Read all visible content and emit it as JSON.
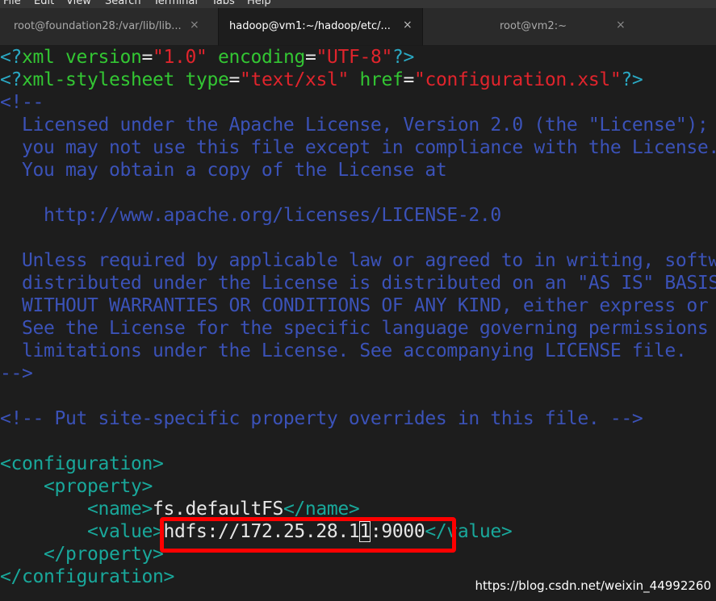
{
  "menu": {
    "items": [
      "File",
      "Edit",
      "View",
      "Search",
      "Terminal",
      "Tabs",
      "Help"
    ]
  },
  "tabs": [
    {
      "label": "root@foundation28:/var/lib/lib...",
      "close": "×",
      "active": false
    },
    {
      "label": "hadoop@vm1:~/hadoop/etc/...",
      "close": "×",
      "active": true
    },
    {
      "label": "root@vm2:~",
      "close": "×",
      "active": false
    }
  ],
  "colors": {
    "punct": "#2aa9c4",
    "keyword": "#33c633",
    "string": "#e0242c",
    "comment": "#3b52b8",
    "tag": "#19a89b",
    "text": "#e6e6e6",
    "highlight": "#ff0000"
  },
  "xml": {
    "decl": {
      "open": "<?",
      "name": "xml",
      "attr1": "version",
      "eq": "=",
      "val1": "\"1.0\"",
      "attr2": "encoding",
      "val2": "\"UTF-8\"",
      "close": "?>"
    },
    "stylesheet": {
      "open": "<?",
      "name": "xml-stylesheet",
      "attr1": "type",
      "eq": "=",
      "val1": "\"text/xsl\"",
      "attr2": "href",
      "val2": "\"configuration.xsl\"",
      "close": "?>"
    },
    "license_comment": [
      "<!--",
      "  Licensed under the Apache License, Version 2.0 (the \"License\");",
      "  you may not use this file except in compliance with the License.",
      "  You may obtain a copy of the License at",
      "",
      "    http://www.apache.org/licenses/LICENSE-2.0",
      "",
      "  Unless required by applicable law or agreed to in writing, software",
      "  distributed under the License is distributed on an \"AS IS\" BASIS,",
      "  WITHOUT WARRANTIES OR CONDITIONS OF ANY KIND, either express or implied.",
      "  See the License for the specific language governing permissions and",
      "  limitations under the License. See accompanying LICENSE file.",
      "-->"
    ],
    "site_comment": "<!-- Put site-specific property overrides in this file. -->",
    "configuration_open": "<configuration>",
    "property_open": "<property>",
    "name_open": "<name>",
    "name_value": "fs.defaultFS",
    "name_close": "</name>",
    "value_open": "<value>",
    "value_before_cursor": "hdfs://172.25.28.1",
    "value_cursor_char": "1",
    "value_after_cursor": ":9000",
    "value_close": "</value>",
    "property_close": "</property>",
    "configuration_close": "</configuration>"
  },
  "watermark": "https://blog.csdn.net/weixin_44992260"
}
